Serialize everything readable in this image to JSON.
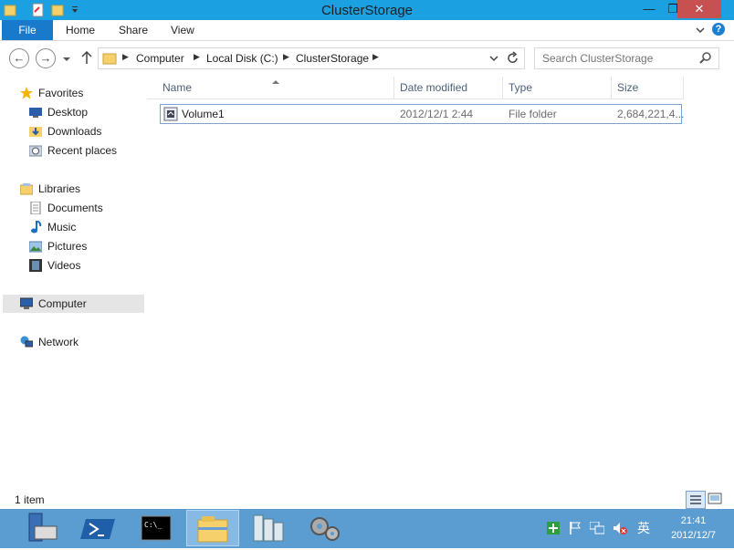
{
  "window": {
    "title": "ClusterStorage",
    "controls": {
      "minimize": "—",
      "maximize": "❐",
      "close": "✕"
    }
  },
  "ribbon": {
    "tabs": [
      "File",
      "Home",
      "Share",
      "View"
    ]
  },
  "address": {
    "crumbs": [
      "Computer",
      "Local Disk (C:)",
      "ClusterStorage"
    ]
  },
  "search": {
    "placeholder": "Search ClusterStorage"
  },
  "nav": {
    "favorites": {
      "label": "Favorites",
      "items": [
        "Desktop",
        "Downloads",
        "Recent places"
      ]
    },
    "libraries": {
      "label": "Libraries",
      "items": [
        "Documents",
        "Music",
        "Pictures",
        "Videos"
      ]
    },
    "computer": "Computer",
    "network": "Network"
  },
  "columns": [
    "Name",
    "Date modified",
    "Type",
    "Size"
  ],
  "files": [
    {
      "name": "Volume1",
      "date": "2012/12/1 2:44",
      "type": "File folder",
      "size": "2,684,221,4..."
    }
  ],
  "status": {
    "count": "1 item"
  },
  "tray": {
    "time": "21:41",
    "date": "2012/12/7",
    "ime": "英"
  },
  "colors": {
    "titlebar": "#1ba1e2",
    "file_tab": "#1979ca",
    "taskbar": "#5c9dd1",
    "close": "#c75050"
  }
}
